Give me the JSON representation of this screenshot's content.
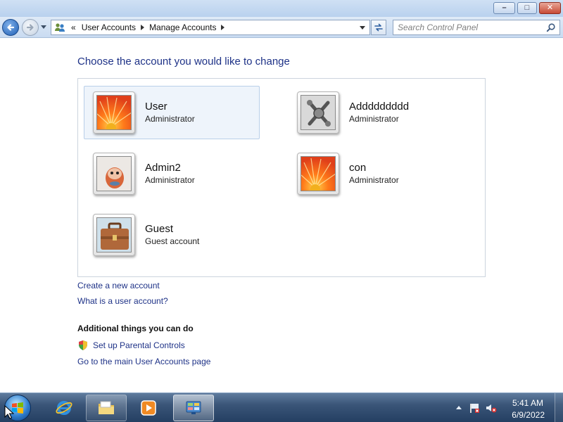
{
  "window": {
    "minimize_label": "–",
    "maximize_label": "□",
    "close_label": "✕"
  },
  "navigation": {
    "breadcrumb_overflow": "«",
    "breadcrumbs": [
      "User Accounts",
      "Manage Accounts"
    ],
    "search_placeholder": "Search Control Panel"
  },
  "main": {
    "title": "Choose the account you would like to change",
    "accounts": [
      {
        "name": "User",
        "type": "Administrator",
        "picture": "flower",
        "selected": true
      },
      {
        "name": "Addddddddd",
        "type": "Administrator",
        "picture": "robot-tools",
        "selected": false
      },
      {
        "name": "Admin2",
        "type": "Administrator",
        "picture": "fish",
        "selected": false
      },
      {
        "name": "con",
        "type": "Administrator",
        "picture": "flower",
        "selected": false
      },
      {
        "name": "Guest",
        "type": "Guest account",
        "picture": "briefcase",
        "selected": false
      }
    ],
    "links": {
      "create_account": "Create a new account",
      "what_is": "What is a user account?"
    },
    "additional": {
      "heading": "Additional things you can do",
      "parental_controls": "Set up Parental Controls",
      "main_page": "Go to the main User Accounts page"
    }
  },
  "taskbar": {
    "items": [
      {
        "name": "internet-explorer",
        "pinned": true
      },
      {
        "name": "windows-explorer",
        "pinned": true
      },
      {
        "name": "media-player",
        "pinned": true
      },
      {
        "name": "control-panel",
        "active": true
      }
    ],
    "time": "5:41 AM",
    "date": "6/9/2022"
  },
  "colors": {
    "link": "#1e3287",
    "selected_bg": "#eef4fb",
    "taskbar": "#3a5578"
  }
}
